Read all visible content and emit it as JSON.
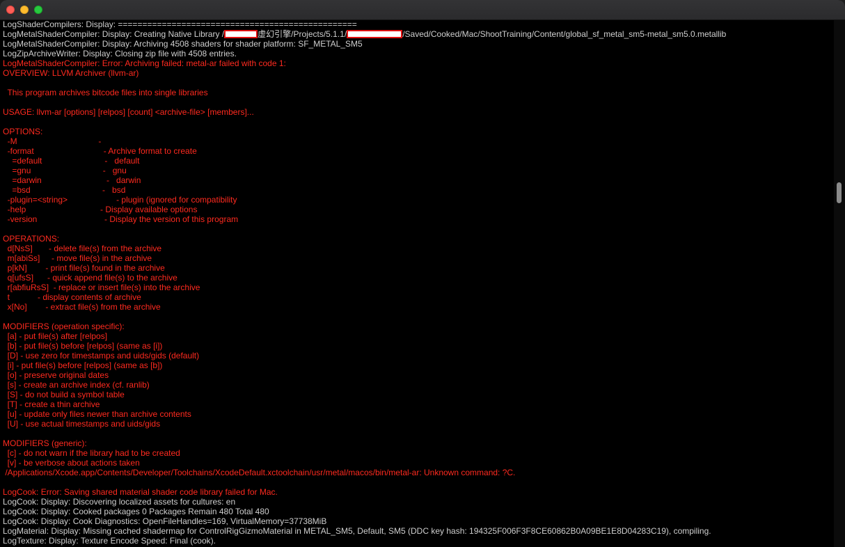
{
  "window": {
    "colors": {
      "background": "#000000",
      "normal_text": "#cfcfcf",
      "error_text": "#ff2a1f",
      "close": "#fe5f57",
      "minimize": "#febc2e",
      "zoom": "#28c840"
    }
  },
  "terminal": {
    "lines": [
      {
        "t": "LogShaderCompilers: Display: ================================================="
      },
      {
        "t": "LogMetalShaderCompiler: Display: Creating Native Library /",
        "r1": true,
        "t2": "虚幻引擎/Projects/5.1.1/",
        "r2": true,
        "t3": "/Saved/Cooked/Mac/ShootTraining/Content/global_sf_metal_sm5-metal_sm5.0.metallib"
      },
      {
        "t": "LogMetalShaderCompiler: Display: Archiving 4508 shaders for shader platform: SF_METAL_SM5"
      },
      {
        "t": "LogZipArchiveWriter: Display: Closing zip file with 4508 entries."
      },
      {
        "t": "LogMetalShaderCompiler: Error: Archiving failed: metal-ar failed with code 1:",
        "err": true
      },
      {
        "t": "OVERVIEW: LLVM Archiver (llvm-ar)",
        "err": true
      },
      {
        "t": "",
        "err": true
      },
      {
        "t": "  This program archives bitcode files into single libraries",
        "err": true
      },
      {
        "t": "",
        "err": true
      },
      {
        "t": "USAGE: llvm-ar [options] [relpos] [count] <archive-file> [members]...",
        "err": true
      },
      {
        "t": "",
        "err": true
      },
      {
        "t": "OPTIONS:",
        "err": true
      },
      {
        "t": "  -M                                   -",
        "err": true
      },
      {
        "t": "  -format                              - Archive format to create",
        "err": true
      },
      {
        "t": "    =default                           -   default",
        "err": true
      },
      {
        "t": "    =gnu                               -   gnu",
        "err": true
      },
      {
        "t": "    =darwin                            -   darwin",
        "err": true
      },
      {
        "t": "    =bsd                               -   bsd",
        "err": true
      },
      {
        "t": "  -plugin=<string>                     - plugin (ignored for compatibility",
        "err": true
      },
      {
        "t": "  -help                                - Display available options",
        "err": true
      },
      {
        "t": "  -version                             - Display the version of this program",
        "err": true
      },
      {
        "t": "",
        "err": true
      },
      {
        "t": "OPERATIONS:",
        "err": true
      },
      {
        "t": "  d[NsS]       - delete file(s) from the archive",
        "err": true
      },
      {
        "t": "  m[abiSs]     - move file(s) in the archive",
        "err": true
      },
      {
        "t": "  p[kN]        - print file(s) found in the archive",
        "err": true
      },
      {
        "t": "  q[ufsS]      - quick append file(s) to the archive",
        "err": true
      },
      {
        "t": "  r[abfiuRsS]  - replace or insert file(s) into the archive",
        "err": true
      },
      {
        "t": "  t            - display contents of archive",
        "err": true
      },
      {
        "t": "  x[No]        - extract file(s) from the archive",
        "err": true
      },
      {
        "t": "",
        "err": true
      },
      {
        "t": "MODIFIERS (operation specific):",
        "err": true
      },
      {
        "t": "  [a] - put file(s) after [relpos]",
        "err": true
      },
      {
        "t": "  [b] - put file(s) before [relpos] (same as [i])",
        "err": true
      },
      {
        "t": "  [D] - use zero for timestamps and uids/gids (default)",
        "err": true
      },
      {
        "t": "  [i] - put file(s) before [relpos] (same as [b])",
        "err": true
      },
      {
        "t": "  [o] - preserve original dates",
        "err": true
      },
      {
        "t": "  [s] - create an archive index (cf. ranlib)",
        "err": true
      },
      {
        "t": "  [S] - do not build a symbol table",
        "err": true
      },
      {
        "t": "  [T] - create a thin archive",
        "err": true
      },
      {
        "t": "  [u] - update only files newer than archive contents",
        "err": true
      },
      {
        "t": "  [U] - use actual timestamps and uids/gids",
        "err": true
      },
      {
        "t": "",
        "err": true
      },
      {
        "t": "MODIFIERS (generic):",
        "err": true
      },
      {
        "t": "  [c] - do not warn if the library had to be created",
        "err": true
      },
      {
        "t": "  [v] - be verbose about actions taken",
        "err": true
      },
      {
        "t": " /Applications/Xcode.app/Contents/Developer/Toolchains/XcodeDefault.xctoolchain/usr/metal/macos/bin/metal-ar: Unknown command: ?C.",
        "err": true
      },
      {
        "t": "",
        "err": true
      },
      {
        "t": "LogCook: Error: Saving shared material shader code library failed for Mac.",
        "err": true
      },
      {
        "t": "LogCook: Display: Discovering localized assets for cultures: en"
      },
      {
        "t": "LogCook: Display: Cooked packages 0 Packages Remain 480 Total 480"
      },
      {
        "t": "LogCook: Display: Cook Diagnostics: OpenFileHandles=169, VirtualMemory=37738MiB"
      },
      {
        "t": "LogMaterial: Display: Missing cached shadermap for ControlRigGizmoMaterial in METAL_SM5, Default, SM5 (DDC key hash: 194325F006F3F8CE60862B0A09BE1E8D04283C19), compiling."
      },
      {
        "t": "LogTexture: Display: Texture Encode Speed: Final (cook)."
      }
    ]
  },
  "scrollbar": {
    "position_fraction": 0.31
  }
}
